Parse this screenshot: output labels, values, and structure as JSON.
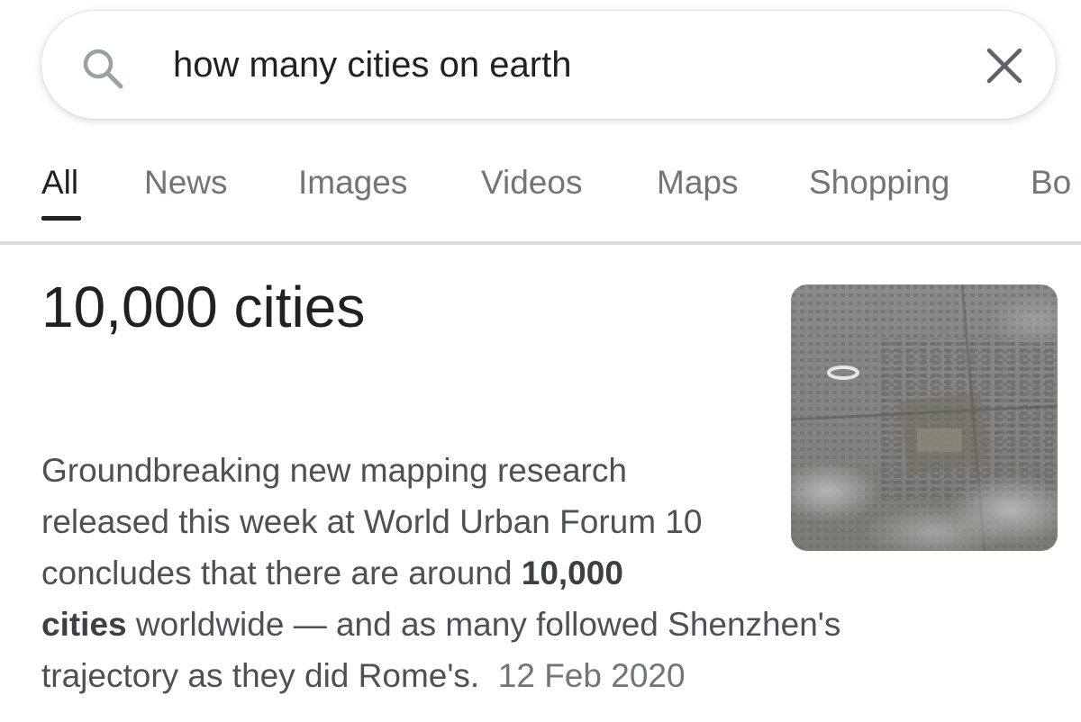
{
  "search": {
    "query": "how many cities on earth"
  },
  "tabs": [
    {
      "label": "All",
      "active": true
    },
    {
      "label": "News"
    },
    {
      "label": "Images"
    },
    {
      "label": "Videos"
    },
    {
      "label": "Maps"
    },
    {
      "label": "Shopping"
    },
    {
      "label": "Bo"
    }
  ],
  "answer": {
    "title": "10,000 cities",
    "image_icon": "aerial-city-photo",
    "snippet": {
      "line1": "Groundbreaking new mapping research",
      "line2": "released this week at World Urban Forum 10",
      "line3_pre": "concludes that there are around ",
      "line3_bold": "10,000",
      "line4_bold": "cities",
      "line4_post": " worldwide — and as many followed Shenzhen's",
      "line5": "trajectory as they did Rome's.",
      "date": "12 Feb 2020"
    }
  },
  "colors": {
    "text_primary": "#202124",
    "text_secondary": "#70757a",
    "snippet_text": "#4d5156",
    "divider": "#dadce0"
  }
}
